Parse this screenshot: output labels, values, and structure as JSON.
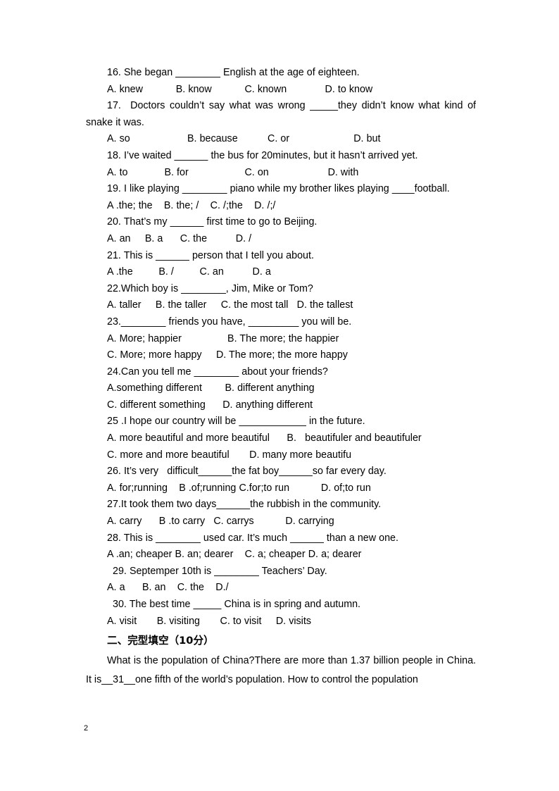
{
  "page": {
    "number": "2",
    "text_color": "#000000",
    "background_color": "#ffffff"
  },
  "questions": [
    {
      "id": "q16",
      "stem": "16. She began ________ English at the age of eighteen.",
      "options_line": "A. knew\t\tB. know\t\tC. known\t\t    D. to know"
    },
    {
      "id": "q17",
      "stem": "17.  Doctors couldn’t say what was wrong _____they didn’t know what kind of snake it was.",
      "options_line": "A. so\t\t    B. because\t\tC. or\t\t      D. but"
    },
    {
      "id": "q18",
      "stem": "18. I’ve waited ______ the bus for 20minutes, but it hasn’t arrived yet.",
      "options_line": "A. to\t\t    B. for\t\t        C. on\t\t     D. with"
    },
    {
      "id": "q19",
      "stem": "19. I like playing ________ piano while my brother likes playing ____football.",
      "options_line": "A .the; the    B. the; /    C. /;the    D. /;/"
    },
    {
      "id": "q20",
      "stem": "20. That’s my ______ first time to go to Beijing.",
      "options_line": "A. an     B. a      C. the          D. /"
    },
    {
      "id": "q21",
      "stem": "21. This is ______ person that I tell you about.",
      "options_line": "A .the         B. /         C. an          D. a"
    },
    {
      "id": "q22",
      "stem": "22.Which boy is ________, Jim, Mike or Tom?",
      "options_line": "A. taller     B. the taller     C. the most tall   D. the tallest"
    },
    {
      "id": "q23",
      "stem": "23.________ friends you have, _________ you will be.",
      "options_line_1": "A. More; happier                B. The more; the happier",
      "options_line_2": "C. More; more happy     D. The more; the more happy"
    },
    {
      "id": "q24",
      "stem": "24.Can you tell me ________ about your friends?",
      "options_line_1": "A.something different        B. different anything",
      "options_line_2": "C. different something      D. anything different"
    },
    {
      "id": "q25",
      "stem": "25 .I hope our country will be ____________ in the future.",
      "options_line_1": "A. more beautiful and more beautiful      B.   beautifuler and beautifuler",
      "options_line_2": "C. more and more beautiful       D. many more beautifu"
    },
    {
      "id": "q26",
      "stem": "26. It’s very   difficult______the fat boy______so far every day.",
      "options_line": "A. for;running    B .of;running C.for;to run           D. of;to run"
    },
    {
      "id": "q27",
      "stem": "27.It took them two days______the rubbish in the community.",
      "options_line": "A. carry      B .to carry   C. carrys           D. carrying"
    },
    {
      "id": "q28",
      "stem": "28. This is ________ used car. It’s much ______ than a new one.",
      "options_line": "A .an; cheaper B. an; dearer    C. a; cheaper D. a; dearer"
    },
    {
      "id": "q29",
      "stem": "29. Septemper 10th is ________ Teachers’ Day.",
      "options_line": "A. a      B. an    C. the    D./"
    },
    {
      "id": "q30",
      "stem": "30. The best time _____ China is in spring and autumn.",
      "options_line": "A. visit       B. visiting       C. to visit     D. visits"
    }
  ],
  "section_two": {
    "heading": "二、完型填空（10分）",
    "paragraph": "What is the population of China?There are more than 1.37 billion people in China. It is__31__one fifth of the world’s population. How to control the population"
  }
}
